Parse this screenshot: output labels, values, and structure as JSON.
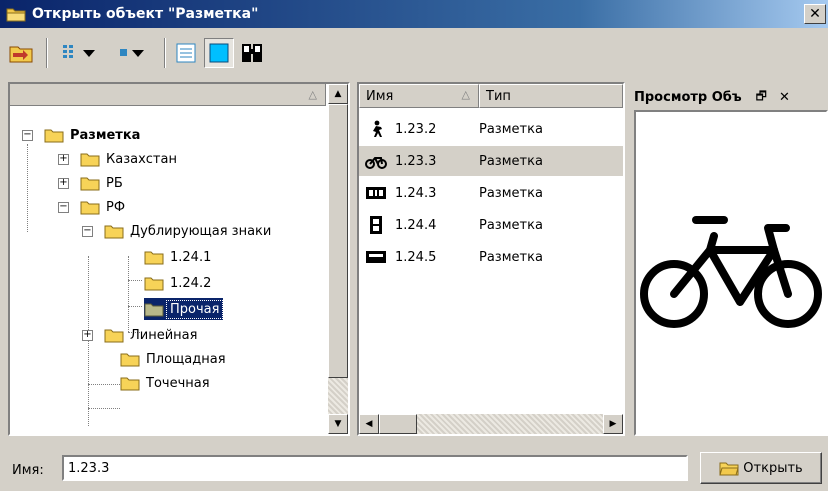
{
  "window": {
    "title": "Открыть объект \"Разметка\"",
    "close_label": "✕"
  },
  "tree": {
    "items": [
      {
        "label": "Разметка",
        "bold": true
      },
      {
        "label": "Казахстан"
      },
      {
        "label": "РБ"
      },
      {
        "label": "РФ"
      },
      {
        "label": "Дублирующая знаки"
      },
      {
        "label": "1.24.1"
      },
      {
        "label": "1.24.2"
      },
      {
        "label": "Прочая",
        "selected": true
      },
      {
        "label": "Линейная"
      },
      {
        "label": "Площадная"
      },
      {
        "label": "Точечная"
      }
    ]
  },
  "list": {
    "columns": [
      "Имя",
      "Тип"
    ],
    "rows": [
      {
        "name": "1.23.2",
        "type": "Разметка",
        "icon": "pedestrian-icon"
      },
      {
        "name": "1.23.3",
        "type": "Разметка",
        "icon": "bicycle-icon",
        "selected": true
      },
      {
        "name": "1.24.3",
        "type": "Разметка",
        "icon": "sign-1-24-3-icon"
      },
      {
        "name": "1.24.4",
        "type": "Разметка",
        "icon": "sign-1-24-4-icon"
      },
      {
        "name": "1.24.5",
        "type": "Разметка",
        "icon": "sign-1-24-5-icon"
      }
    ]
  },
  "preview": {
    "title": "Просмотр Объ",
    "pin": "🗗",
    "close": "✕"
  },
  "footer": {
    "name_label": "Имя:",
    "name_value": "1.23.3",
    "open_label": "Открыть"
  },
  "colors": {
    "selection": "#0a246a",
    "title_start": "#0a246a",
    "face": "#d4d0c8"
  }
}
